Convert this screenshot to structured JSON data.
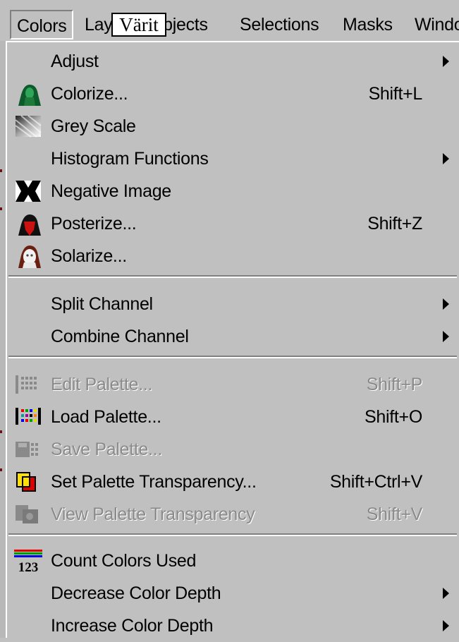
{
  "menubar": {
    "items": [
      {
        "label": "Colors"
      },
      {
        "label": "Layers"
      },
      {
        "label": "Objects"
      },
      {
        "label": "Selections"
      },
      {
        "label": "Masks"
      },
      {
        "label": "Window"
      }
    ],
    "overlay_label": "Värit"
  },
  "menu": {
    "items": [
      {
        "label": "Adjust",
        "shortcut": "",
        "submenu": true,
        "enabled": true,
        "icon": ""
      },
      {
        "label": "Colorize...",
        "shortcut": "Shift+L",
        "submenu": false,
        "enabled": true,
        "icon": "colorize-icon"
      },
      {
        "label": "Grey Scale",
        "shortcut": "",
        "submenu": false,
        "enabled": true,
        "icon": "grey-scale-icon"
      },
      {
        "label": "Histogram Functions",
        "shortcut": "",
        "submenu": true,
        "enabled": true,
        "icon": ""
      },
      {
        "label": "Negative Image",
        "shortcut": "",
        "submenu": false,
        "enabled": true,
        "icon": "negative-image-icon"
      },
      {
        "label": "Posterize...",
        "shortcut": "Shift+Z",
        "submenu": false,
        "enabled": true,
        "icon": "posterize-icon"
      },
      {
        "label": "Solarize...",
        "shortcut": "",
        "submenu": false,
        "enabled": true,
        "icon": "solarize-icon"
      },
      {
        "label": "Split Channel",
        "shortcut": "",
        "submenu": true,
        "enabled": true,
        "icon": ""
      },
      {
        "label": "Combine Channel",
        "shortcut": "",
        "submenu": true,
        "enabled": true,
        "icon": ""
      },
      {
        "label": "Edit Palette...",
        "shortcut": "Shift+P",
        "submenu": false,
        "enabled": false,
        "icon": "edit-palette-icon"
      },
      {
        "label": "Load Palette...",
        "shortcut": "Shift+O",
        "submenu": false,
        "enabled": true,
        "icon": "load-palette-icon"
      },
      {
        "label": "Save Palette...",
        "shortcut": "",
        "submenu": false,
        "enabled": false,
        "icon": "save-palette-icon"
      },
      {
        "label": "Set Palette Transparency...",
        "shortcut": "Shift+Ctrl+V",
        "submenu": false,
        "enabled": true,
        "icon": "set-palette-transparency-icon"
      },
      {
        "label": "View Palette Transparency",
        "shortcut": "Shift+V",
        "submenu": false,
        "enabled": false,
        "icon": "view-palette-transparency-icon"
      },
      {
        "label": "Count Colors Used",
        "shortcut": "",
        "submenu": false,
        "enabled": true,
        "icon": "count-colors-icon",
        "icon_text": "123"
      },
      {
        "label": "Decrease Color Depth",
        "shortcut": "",
        "submenu": true,
        "enabled": true,
        "icon": ""
      },
      {
        "label": "Increase Color Depth",
        "shortcut": "",
        "submenu": true,
        "enabled": true,
        "icon": ""
      }
    ]
  },
  "colors": {
    "menu_bg": "#c0c0c0",
    "disabled_text": "#8a8a8a",
    "colorize_green": "#1d7a3a",
    "posterize_red": "#cc1111"
  }
}
